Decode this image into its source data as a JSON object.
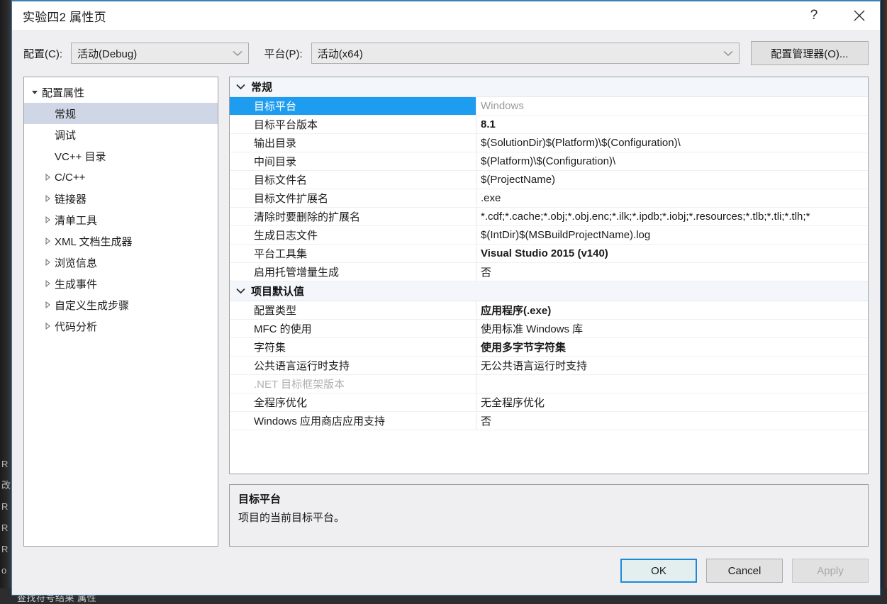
{
  "window": {
    "title": "实验四2 属性页",
    "help_icon": "question-mark-icon",
    "close_icon": "close-x-icon"
  },
  "config_bar": {
    "configuration_label": "配置(C):",
    "configuration_value": "活动(Debug)",
    "platform_label": "平台(P):",
    "platform_value": "活动(x64)",
    "config_manager_label": "配置管理器(O)..."
  },
  "tree": {
    "root": {
      "label": "配置属性",
      "expanded": true
    },
    "items": [
      {
        "label": "常规",
        "selected": true,
        "expandable": false
      },
      {
        "label": "调试",
        "selected": false,
        "expandable": false
      },
      {
        "label": "VC++ 目录",
        "selected": false,
        "expandable": false
      },
      {
        "label": "C/C++",
        "selected": false,
        "expandable": true
      },
      {
        "label": "链接器",
        "selected": false,
        "expandable": true
      },
      {
        "label": "清单工具",
        "selected": false,
        "expandable": true
      },
      {
        "label": "XML 文档生成器",
        "selected": false,
        "expandable": true
      },
      {
        "label": "浏览信息",
        "selected": false,
        "expandable": true
      },
      {
        "label": "生成事件",
        "selected": false,
        "expandable": true
      },
      {
        "label": "自定义生成步骤",
        "selected": false,
        "expandable": true
      },
      {
        "label": "代码分析",
        "selected": false,
        "expandable": true
      }
    ]
  },
  "grid": {
    "sections": [
      {
        "title": "常规",
        "expanded": true,
        "rows": [
          {
            "name": "目标平台",
            "value": "Windows",
            "selected": true,
            "bold": false,
            "disabled": false
          },
          {
            "name": "目标平台版本",
            "value": "8.1",
            "selected": false,
            "bold": true,
            "disabled": false
          },
          {
            "name": "输出目录",
            "value": "$(SolutionDir)$(Platform)\\$(Configuration)\\",
            "selected": false,
            "bold": false,
            "disabled": false
          },
          {
            "name": "中间目录",
            "value": "$(Platform)\\$(Configuration)\\",
            "selected": false,
            "bold": false,
            "disabled": false
          },
          {
            "name": "目标文件名",
            "value": "$(ProjectName)",
            "selected": false,
            "bold": false,
            "disabled": false
          },
          {
            "name": "目标文件扩展名",
            "value": ".exe",
            "selected": false,
            "bold": false,
            "disabled": false
          },
          {
            "name": "清除时要删除的扩展名",
            "value": "*.cdf;*.cache;*.obj;*.obj.enc;*.ilk;*.ipdb;*.iobj;*.resources;*.tlb;*.tli;*.tlh;*",
            "selected": false,
            "bold": false,
            "disabled": false
          },
          {
            "name": "生成日志文件",
            "value": "$(IntDir)$(MSBuildProjectName).log",
            "selected": false,
            "bold": false,
            "disabled": false
          },
          {
            "name": "平台工具集",
            "value": "Visual Studio 2015 (v140)",
            "selected": false,
            "bold": true,
            "disabled": false
          },
          {
            "name": "启用托管增量生成",
            "value": "否",
            "selected": false,
            "bold": false,
            "disabled": false
          }
        ]
      },
      {
        "title": "项目默认值",
        "expanded": true,
        "rows": [
          {
            "name": "配置类型",
            "value": "应用程序(.exe)",
            "selected": false,
            "bold": true,
            "disabled": false
          },
          {
            "name": "MFC 的使用",
            "value": "使用标准 Windows 库",
            "selected": false,
            "bold": false,
            "disabled": false
          },
          {
            "name": "字符集",
            "value": "使用多字节字符集",
            "selected": false,
            "bold": true,
            "disabled": false
          },
          {
            "name": "公共语言运行时支持",
            "value": "无公共语言运行时支持",
            "selected": false,
            "bold": false,
            "disabled": false
          },
          {
            "name": ".NET 目标框架版本",
            "value": "",
            "selected": false,
            "bold": false,
            "disabled": true
          },
          {
            "name": "全程序优化",
            "value": "无全程序优化",
            "selected": false,
            "bold": false,
            "disabled": false
          },
          {
            "name": "Windows 应用商店应用支持",
            "value": "否",
            "selected": false,
            "bold": false,
            "disabled": false
          }
        ]
      }
    ]
  },
  "description": {
    "title": "目标平台",
    "text": "项目的当前目标平台。"
  },
  "footer": {
    "ok_label": "OK",
    "cancel_label": "Cancel",
    "apply_label": "Apply",
    "apply_disabled": true
  },
  "ide_background": {
    "bottom_tabs": "查找符号结果  属性",
    "left_ghost_chars": [
      "R",
      "改",
      "R",
      "R",
      "R",
      "o"
    ]
  },
  "colors": {
    "selection_blue": "#1e9cf0",
    "tree_selection": "#cfd6e5",
    "focus_border": "#1e8ad6",
    "dialog_bg": "#efeff2",
    "section_header_bg": "#f3f6fa"
  }
}
